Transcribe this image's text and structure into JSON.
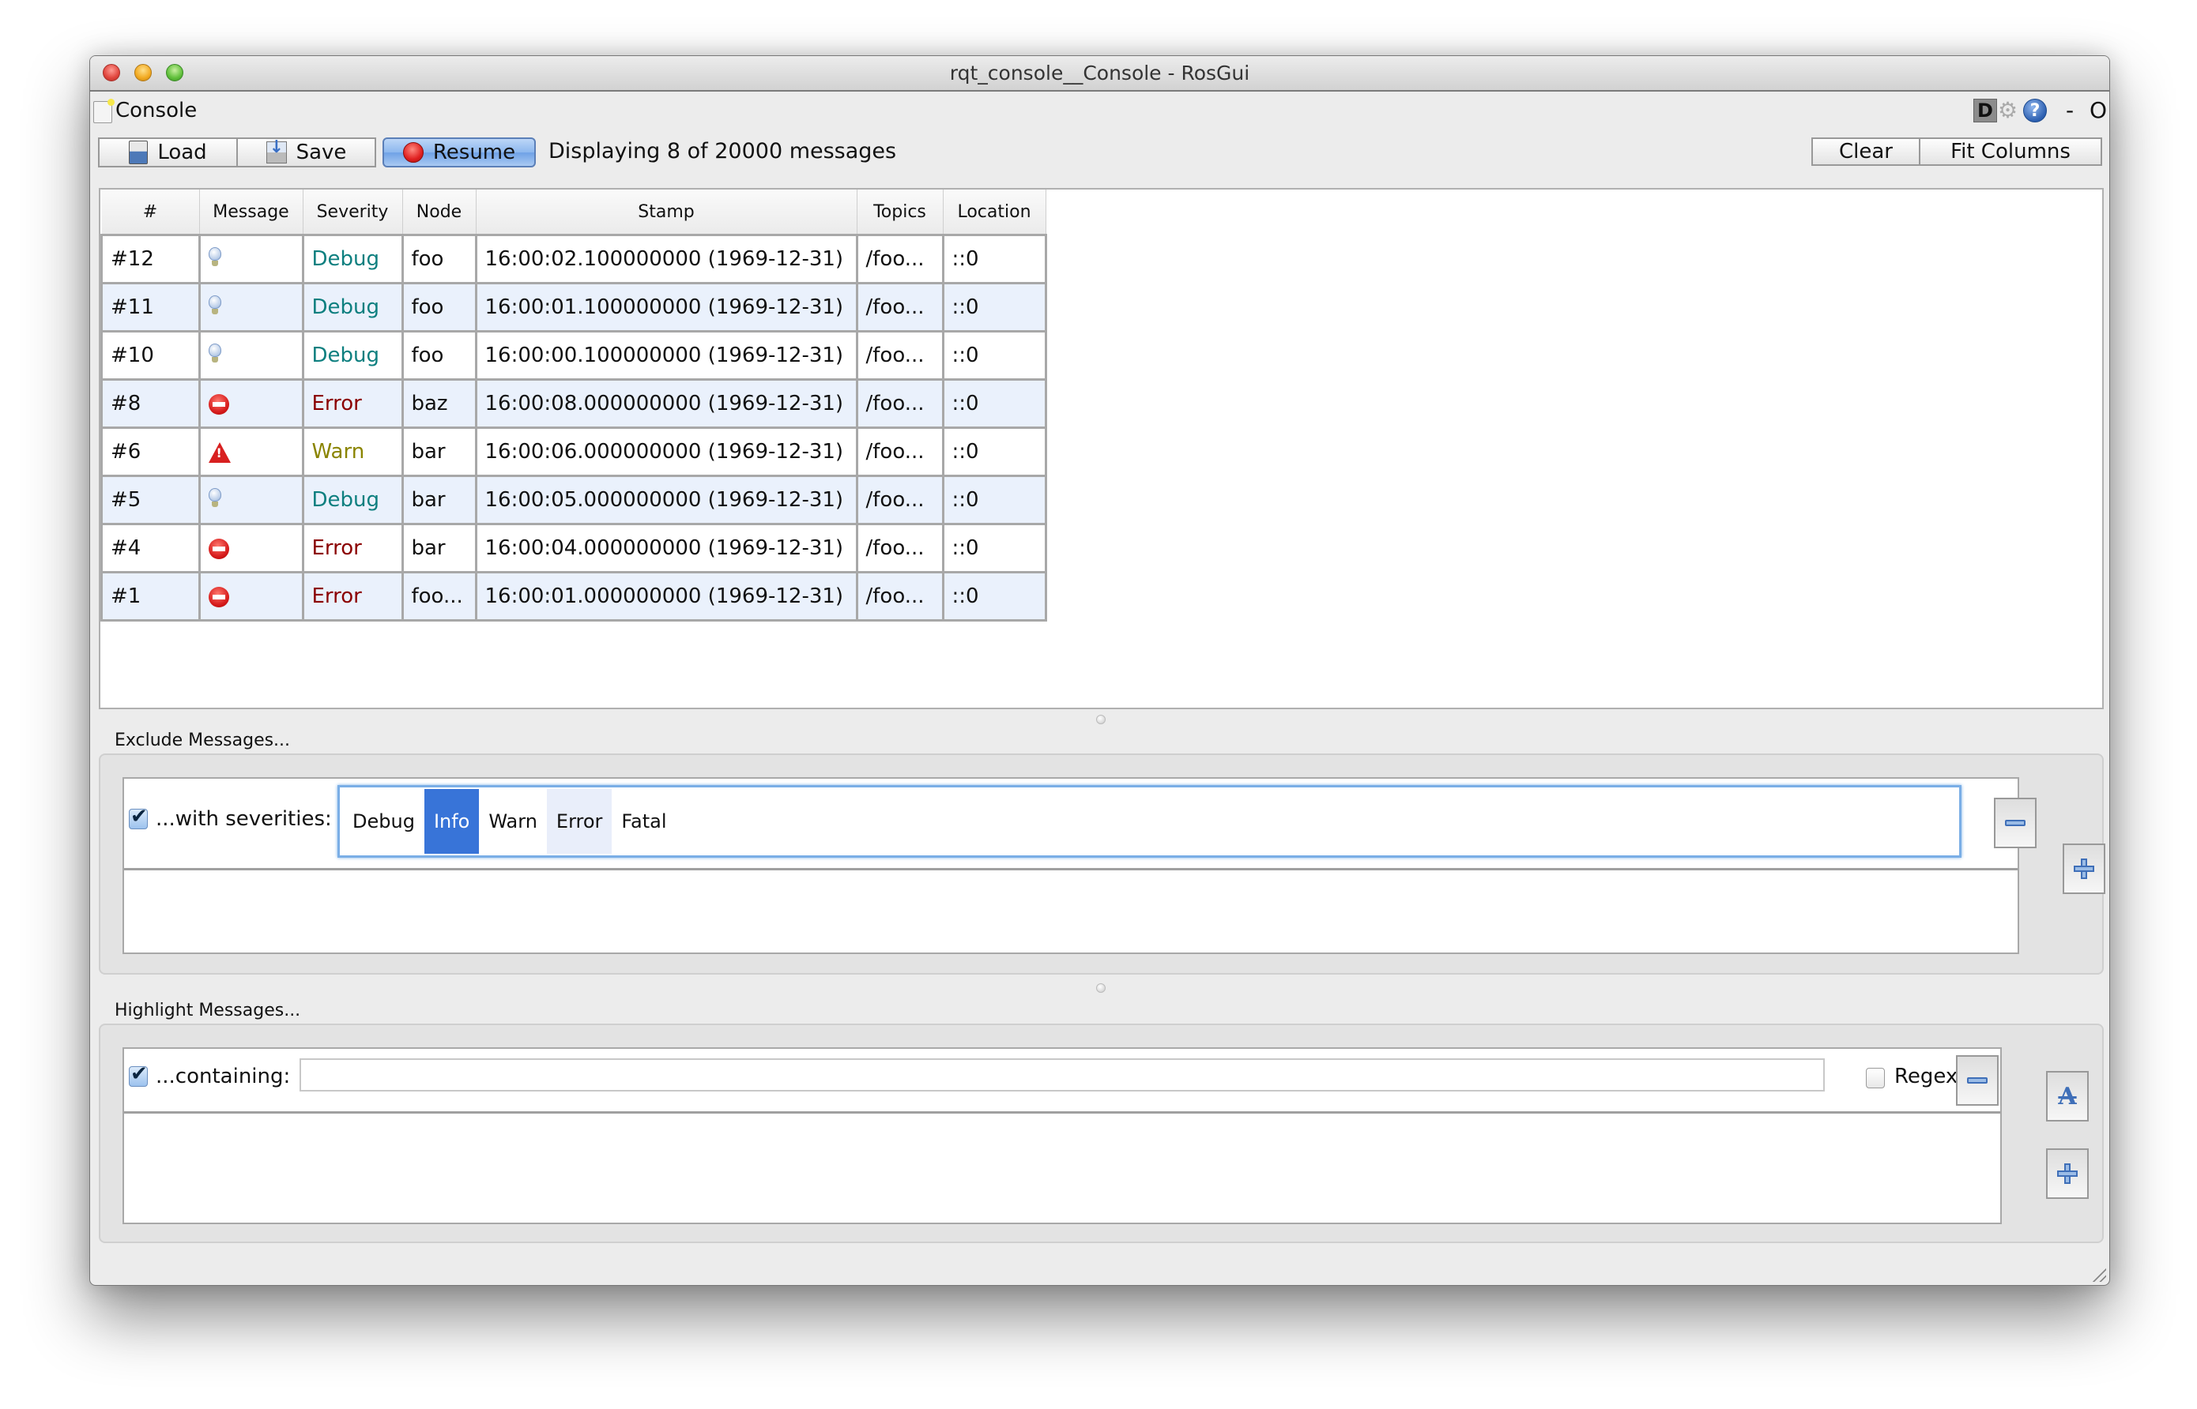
{
  "window": {
    "title": "rqt_console__Console - RosGui",
    "controls": [
      "close",
      "minimize",
      "zoom"
    ]
  },
  "plugin": {
    "title": "Console",
    "dock_buttons": {
      "d_label": "D",
      "gear": "gear-icon",
      "help": "?",
      "minimize": "-",
      "float": "O"
    }
  },
  "toolbar": {
    "load_label": "Load",
    "save_label": "Save",
    "resume_label": "Resume",
    "status": "Displaying 8 of 20000 messages",
    "clear_label": "Clear",
    "fit_columns_label": "Fit Columns"
  },
  "table": {
    "columns": [
      "#",
      "Message",
      "Severity",
      "Node",
      "Stamp",
      "Topics",
      "Location"
    ],
    "rows": [
      {
        "id": "#12",
        "icon": "lightbulb-icon",
        "severity": "Debug",
        "node": "foo",
        "stamp": "16:00:02.100000000 (1969-12-31)",
        "topics": "/foo...",
        "location": "::0"
      },
      {
        "id": "#11",
        "icon": "lightbulb-icon",
        "severity": "Debug",
        "node": "foo",
        "stamp": "16:00:01.100000000 (1969-12-31)",
        "topics": "/foo...",
        "location": "::0"
      },
      {
        "id": "#10",
        "icon": "lightbulb-icon",
        "severity": "Debug",
        "node": "foo",
        "stamp": "16:00:00.100000000 (1969-12-31)",
        "topics": "/foo...",
        "location": "::0"
      },
      {
        "id": "#8",
        "icon": "error-icon",
        "severity": "Error",
        "node": "baz",
        "stamp": "16:00:08.000000000 (1969-12-31)",
        "topics": "/foo...",
        "location": "::0"
      },
      {
        "id": "#6",
        "icon": "warning-icon",
        "severity": "Warn",
        "node": "bar",
        "stamp": "16:00:06.000000000 (1969-12-31)",
        "topics": "/foo...",
        "location": "::0"
      },
      {
        "id": "#5",
        "icon": "lightbulb-icon",
        "severity": "Debug",
        "node": "bar",
        "stamp": "16:00:05.000000000 (1969-12-31)",
        "topics": "/foo...",
        "location": "::0"
      },
      {
        "id": "#4",
        "icon": "error-icon",
        "severity": "Error",
        "node": "bar",
        "stamp": "16:00:04.000000000 (1969-12-31)",
        "topics": "/foo...",
        "location": "::0"
      },
      {
        "id": "#1",
        "icon": "error-icon",
        "severity": "Error",
        "node": "foo...",
        "stamp": "16:00:01.000000000 (1969-12-31)",
        "topics": "/foo...",
        "location": "::0"
      }
    ]
  },
  "exclude": {
    "section_label": "Exclude Messages...",
    "filter_enabled": true,
    "filter_label": "...with severities:",
    "severities": [
      "Debug",
      "Info",
      "Warn",
      "Error",
      "Fatal"
    ],
    "selected": [
      "Info"
    ],
    "hovered": "Error"
  },
  "highlight": {
    "section_label": "Highlight Messages...",
    "filter_enabled": true,
    "filter_label": "...containing:",
    "text_value": "",
    "regex_label": "Regex",
    "regex_checked": false
  },
  "colors": {
    "debug": "#0d7f7f",
    "error": "#8b0000",
    "warn": "#8a8400",
    "selection": "#3874d8",
    "alt_row": "#eaf1fc"
  }
}
